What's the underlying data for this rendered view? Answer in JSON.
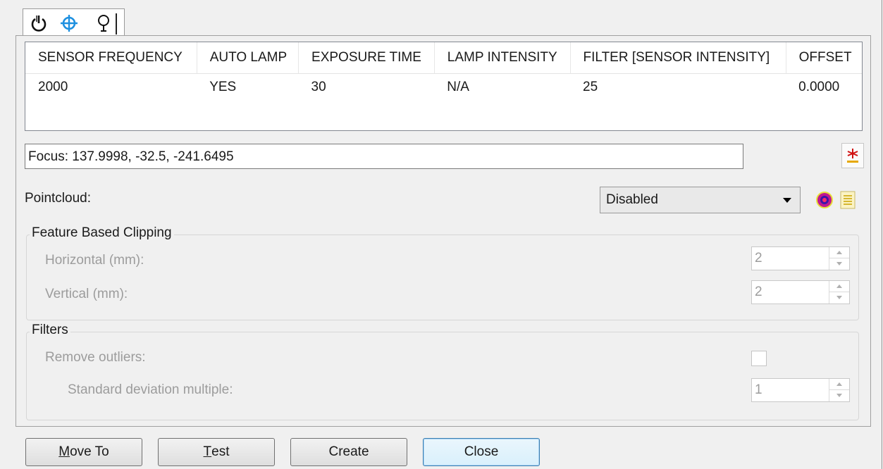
{
  "tabs": [
    {
      "icon": "power-icon"
    },
    {
      "icon": "crosshair-icon"
    },
    {
      "icon": "lamp-icon"
    }
  ],
  "grid": {
    "columns": [
      "SENSOR FREQUENCY",
      "AUTO LAMP",
      "EXPOSURE TIME",
      "LAMP INTENSITY",
      "FILTER [SENSOR INTENSITY]",
      "OFFSET"
    ],
    "rows": [
      [
        "2000",
        "YES",
        "30",
        "N/A",
        "25",
        "0.0000"
      ]
    ]
  },
  "focus": {
    "value": "Focus: 137.9998, -32.5, -241.6495"
  },
  "pointcloud": {
    "label": "Pointcloud:",
    "selected": "Disabled"
  },
  "clipping": {
    "title": "Feature Based Clipping",
    "horizontal_label": "Horizontal (mm):",
    "horizontal_value": "2",
    "vertical_label": "Vertical (mm):",
    "vertical_value": "2"
  },
  "filters": {
    "title": "Filters",
    "remove_outliers_label": "Remove outliers:",
    "std_dev_label": "Standard deviation multiple:",
    "std_dev_value": "1"
  },
  "buttons": {
    "move_to_first": "M",
    "move_to_rest": "ove To",
    "test_first": "T",
    "test_rest": "est",
    "create": "Create",
    "close": "Close"
  },
  "colors": {
    "accent": "#1e90e0",
    "window_bg": "#f0f0f0",
    "disabled_text": "#9c9c9c"
  }
}
